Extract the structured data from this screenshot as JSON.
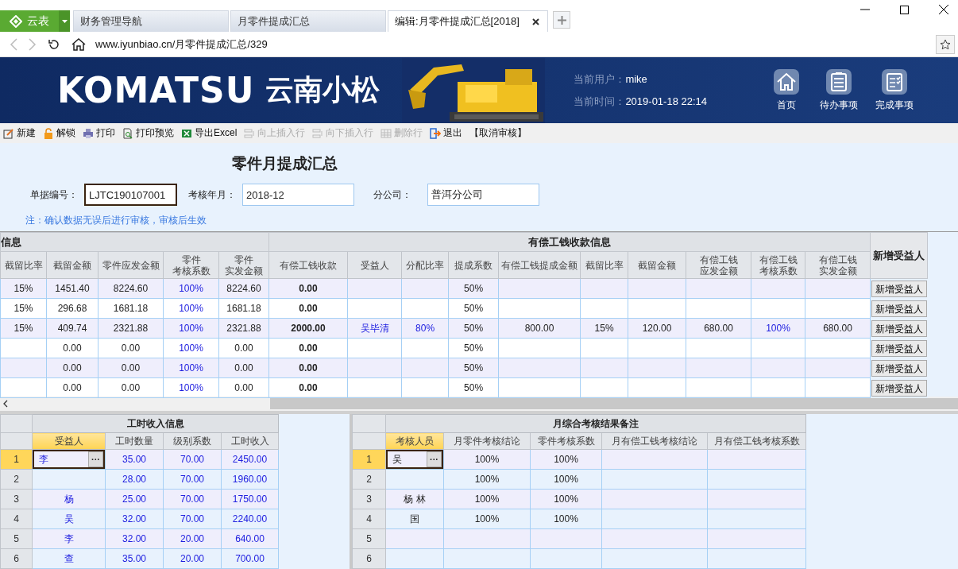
{
  "tabs": {
    "brand": "云表",
    "items": [
      {
        "label": "财务管理导航",
        "selected": false
      },
      {
        "label": "月零件提成汇总",
        "selected": false
      },
      {
        "label": "编辑:月零件提成汇总[2018]",
        "selected": true
      }
    ]
  },
  "address_bar": {
    "url": "www.iyunbiao.cn/月零件提成汇总/329"
  },
  "header": {
    "logo": "KOMATSU",
    "company": "云南小松",
    "user_label": "当前用户：",
    "user": "mike",
    "time_label": "当前时间：",
    "time": "2019-01-18 22:14",
    "nav": [
      {
        "label": "首页"
      },
      {
        "label": "待办事项"
      },
      {
        "label": "完成事项"
      }
    ]
  },
  "toolbar": [
    {
      "label": "新建",
      "disabled": false
    },
    {
      "label": "解锁",
      "disabled": false
    },
    {
      "label": "打印",
      "disabled": false
    },
    {
      "label": "打印预览",
      "disabled": false
    },
    {
      "label": "导出Excel",
      "disabled": false
    },
    {
      "label": "向上插入行",
      "disabled": true
    },
    {
      "label": "向下插入行",
      "disabled": true
    },
    {
      "label": "删除行",
      "disabled": true
    },
    {
      "label": "退出",
      "disabled": false
    },
    {
      "label": "【取消审核】",
      "disabled": false
    }
  ],
  "form": {
    "title": "零件月提成汇总",
    "fields": [
      {
        "label": "单据编号：",
        "value": "LJTC190107001",
        "focused": true
      },
      {
        "label": "考核年月：",
        "value": "2018-12",
        "focused": false
      },
      {
        "label": "分公司：",
        "value": "普洱分公司",
        "focused": false
      }
    ],
    "note": "注：确认数据无误后进行审核，审核后生效"
  },
  "main_grid": {
    "groups": [
      {
        "label": "信息",
        "columns": [
          {
            "label": "截留比率",
            "kind": "plain"
          },
          {
            "label": "截留金额",
            "kind": "plain"
          },
          {
            "label": "零件应发金额",
            "kind": "plain"
          },
          {
            "label": "零件考核系数",
            "kind": "blue",
            "wrap": true
          },
          {
            "label": "零件实发金额",
            "kind": "plain",
            "wrap": true
          }
        ]
      },
      {
        "label": "有偿工钱收款信息",
        "columns": [
          {
            "label": "有偿工钱收款",
            "kind": "bold"
          },
          {
            "label": "受益人",
            "kind": "blue"
          },
          {
            "label": "分配比率",
            "kind": "blue"
          },
          {
            "label": "提成系数",
            "kind": "plain"
          },
          {
            "label": "有偿工钱提成金额",
            "kind": "plain"
          },
          {
            "label": "截留比率",
            "kind": "plain"
          },
          {
            "label": "截留金额",
            "kind": "plain"
          },
          {
            "label": "有偿工钱应发金额",
            "kind": "plain",
            "wrap": true
          },
          {
            "label": "有偿工钱考核系数",
            "kind": "blue",
            "wrap": true
          },
          {
            "label": "有偿工钱实发金额",
            "kind": "plain",
            "wrap": true
          }
        ]
      }
    ],
    "action_column": "新增受益人",
    "rows": [
      {
        "cells": [
          "15%",
          "1451.40",
          "8224.60",
          "100%",
          "8224.60",
          "0.00",
          null,
          null,
          "50%",
          null,
          null,
          null,
          null,
          null,
          null
        ],
        "button": "新增受益人"
      },
      {
        "cells": [
          "15%",
          "296.68",
          "1681.18",
          "100%",
          "1681.18",
          "0.00",
          null,
          null,
          "50%",
          null,
          null,
          null,
          null,
          null,
          null
        ],
        "button": "新增受益人"
      },
      {
        "cells": [
          "15%",
          "409.74",
          "2321.88",
          "100%",
          "2321.88",
          "2000.00",
          "吴毕清",
          "80%",
          "50%",
          "800.00",
          "15%",
          "120.00",
          "680.00",
          "100%",
          "680.00"
        ],
        "button": "新增受益人"
      },
      {
        "cells": [
          null,
          "0.00",
          "0.00",
          "100%",
          "0.00",
          "0.00",
          null,
          null,
          "50%",
          null,
          null,
          null,
          null,
          null,
          null
        ],
        "button": "新增受益人"
      },
      {
        "cells": [
          null,
          "0.00",
          "0.00",
          "100%",
          "0.00",
          "0.00",
          null,
          null,
          "50%",
          null,
          null,
          null,
          null,
          null,
          null
        ],
        "button": "新增受益人"
      },
      {
        "cells": [
          null,
          "0.00",
          "0.00",
          "100%",
          "0.00",
          "0.00",
          null,
          null,
          "50%",
          null,
          null,
          null,
          null,
          null,
          null
        ],
        "button": "新增受益人"
      }
    ]
  },
  "labor_table": {
    "title": "工时收入信息",
    "editor_button": "···",
    "columns": [
      {
        "label": "受益人",
        "selected": true
      },
      {
        "label": "工时数量",
        "selected": false
      },
      {
        "label": "级别系数",
        "selected": false
      },
      {
        "label": "工时收入",
        "selected": false
      }
    ],
    "rows": [
      {
        "number": "1",
        "selected": true,
        "cells": [
          "李",
          "35.00",
          "70.00",
          "2450.00"
        ]
      },
      {
        "number": "2",
        "selected": false,
        "cells": [
          null,
          "28.00",
          "70.00",
          "1960.00"
        ]
      },
      {
        "number": "3",
        "selected": false,
        "cells": [
          "杨",
          "25.00",
          "70.00",
          "1750.00"
        ]
      },
      {
        "number": "4",
        "selected": false,
        "cells": [
          "吴",
          "32.00",
          "70.00",
          "2240.00"
        ]
      },
      {
        "number": "5",
        "selected": false,
        "cells": [
          "李",
          "32.00",
          "20.00",
          "640.00"
        ]
      },
      {
        "number": "6",
        "selected": false,
        "cells": [
          "查",
          "35.00",
          "20.00",
          "700.00"
        ]
      }
    ]
  },
  "review_table": {
    "title": "月综合考核结果备注",
    "editor_button": "···",
    "columns": [
      {
        "label": "考核人员",
        "selected": true
      },
      {
        "label": "月零件考核结论",
        "selected": false
      },
      {
        "label": "零件考核系数",
        "selected": false
      },
      {
        "label": "月有偿工钱考核结论",
        "selected": false
      },
      {
        "label": "月有偿工钱考核系数",
        "selected": false
      }
    ],
    "rows": [
      {
        "number": "1",
        "selected": true,
        "cells": [
          "吴",
          "100%",
          "100%",
          null,
          null
        ]
      },
      {
        "number": "2",
        "selected": false,
        "cells": [
          null,
          "100%",
          "100%",
          null,
          null
        ]
      },
      {
        "number": "3",
        "selected": false,
        "cells": [
          "杨 林",
          "100%",
          "100%",
          null,
          null
        ]
      },
      {
        "number": "4",
        "selected": false,
        "cells": [
          "国",
          "100%",
          "100%",
          null,
          null
        ]
      },
      {
        "number": "5",
        "selected": false,
        "cells": [
          null,
          null,
          null,
          null,
          null
        ]
      },
      {
        "number": "6",
        "selected": false,
        "cells": [
          null,
          null,
          null,
          null,
          null
        ]
      }
    ]
  }
}
